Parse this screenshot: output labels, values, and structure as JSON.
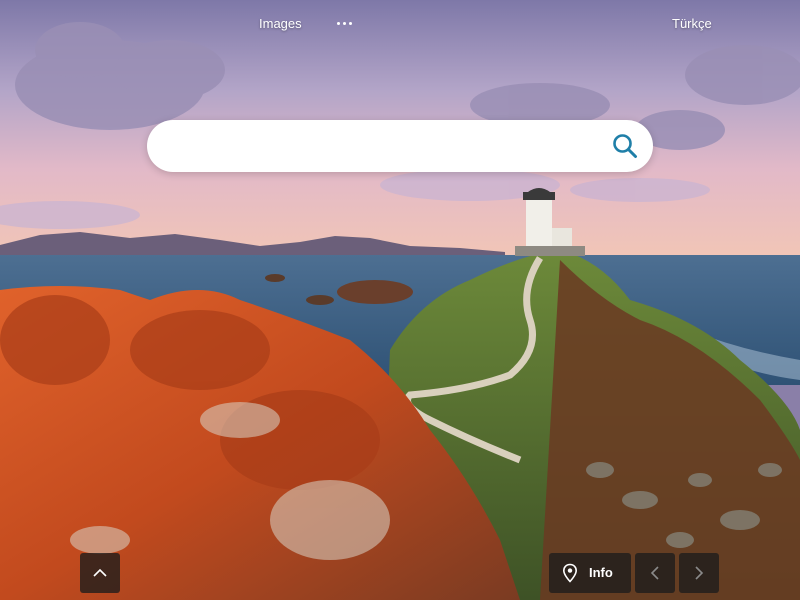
{
  "nav": {
    "images_label": "Images",
    "more_label": "···",
    "language_label": "Türkçe"
  },
  "search": {
    "placeholder": "",
    "value": ""
  },
  "bottom": {
    "info_label": "Info"
  },
  "icons": {
    "search": "search-icon",
    "location": "map-pin-icon",
    "scroll_up": "chevron-up-icon",
    "prev": "chevron-left-icon",
    "next": "chevron-right-icon"
  },
  "colors": {
    "search_icon": "#1f7fa8",
    "button_bg": "#1c1c1c",
    "text_light": "#ffffff"
  }
}
